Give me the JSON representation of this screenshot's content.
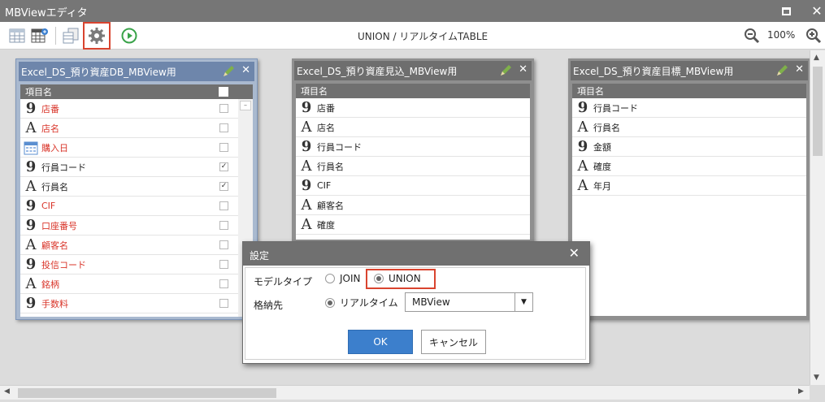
{
  "window": {
    "title": "MBViewエディタ"
  },
  "toolbar": {
    "title": "UNION / リアルタイムTABLE",
    "zoom": "100%"
  },
  "panels": [
    {
      "title": "Excel_DS_預り資産DB_MBView用",
      "header": "項目名",
      "rows": [
        {
          "type": "number",
          "label": "店番",
          "red": true,
          "checked": false
        },
        {
          "type": "text",
          "label": "店名",
          "red": true,
          "checked": false
        },
        {
          "type": "date",
          "label": "購入日",
          "red": true,
          "checked": false
        },
        {
          "type": "number",
          "label": "行員コード",
          "red": false,
          "checked": true
        },
        {
          "type": "text",
          "label": "行員名",
          "red": false,
          "checked": true
        },
        {
          "type": "number",
          "label": "CIF",
          "red": true,
          "checked": false
        },
        {
          "type": "number",
          "label": "口座番号",
          "red": true,
          "checked": false
        },
        {
          "type": "text",
          "label": "顧客名",
          "red": true,
          "checked": false
        },
        {
          "type": "number",
          "label": "投信コード",
          "red": true,
          "checked": false
        },
        {
          "type": "text",
          "label": "銘柄",
          "red": true,
          "checked": false
        },
        {
          "type": "number",
          "label": "手数料",
          "red": true,
          "checked": false
        }
      ]
    },
    {
      "title": "Excel_DS_預り資産見込_MBView用",
      "header": "項目名",
      "rows": [
        {
          "type": "number",
          "label": "店番"
        },
        {
          "type": "text",
          "label": "店名"
        },
        {
          "type": "number",
          "label": "行員コード"
        },
        {
          "type": "text",
          "label": "行員名"
        },
        {
          "type": "number",
          "label": "CIF"
        },
        {
          "type": "text",
          "label": "顧客名"
        },
        {
          "type": "text",
          "label": "確度"
        }
      ]
    },
    {
      "title": "Excel_DS_預り資産目標_MBView用",
      "header": "項目名",
      "rows": [
        {
          "type": "number",
          "label": "行員コード"
        },
        {
          "type": "text",
          "label": "行員名"
        },
        {
          "type": "number",
          "label": "金額"
        },
        {
          "type": "text",
          "label": "確度"
        },
        {
          "type": "text",
          "label": "年月"
        }
      ]
    }
  ],
  "dialog": {
    "title": "設定",
    "model_type_label": "モデルタイプ",
    "join_label": "JOIN",
    "union_label": "UNION",
    "selected_model": "UNION",
    "storage_label": "格納先",
    "realtime_label": "リアルタイム",
    "storage_value": "MBView",
    "ok_label": "OK",
    "cancel_label": "キャンセル"
  }
}
